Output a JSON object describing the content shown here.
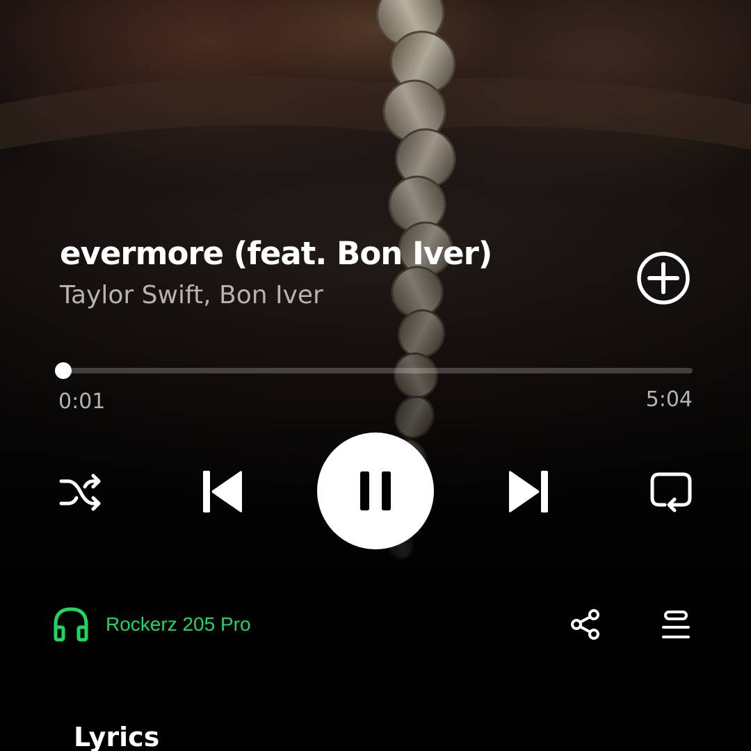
{
  "track": {
    "title": "evermore (feat. Bon Iver)",
    "artists": "Taylor Swift, Bon Iver"
  },
  "playback": {
    "elapsed": "0:01",
    "duration": "5:04",
    "progress_fraction": 0.003,
    "state": "playing"
  },
  "icons": {
    "add": "plus-circle-icon",
    "shuffle": "shuffle-icon",
    "previous": "skip-previous-icon",
    "pause": "pause-icon",
    "next": "skip-next-icon",
    "repeat": "repeat-icon",
    "device": "headphones-icon",
    "share": "share-icon",
    "queue": "queue-icon"
  },
  "device": {
    "name": "Rockerz 205 Pro"
  },
  "lyrics": {
    "heading": "Lyrics"
  },
  "colors": {
    "accent": "#1ed760",
    "background": "#000000",
    "secondary_text": "#b3b3b3"
  }
}
